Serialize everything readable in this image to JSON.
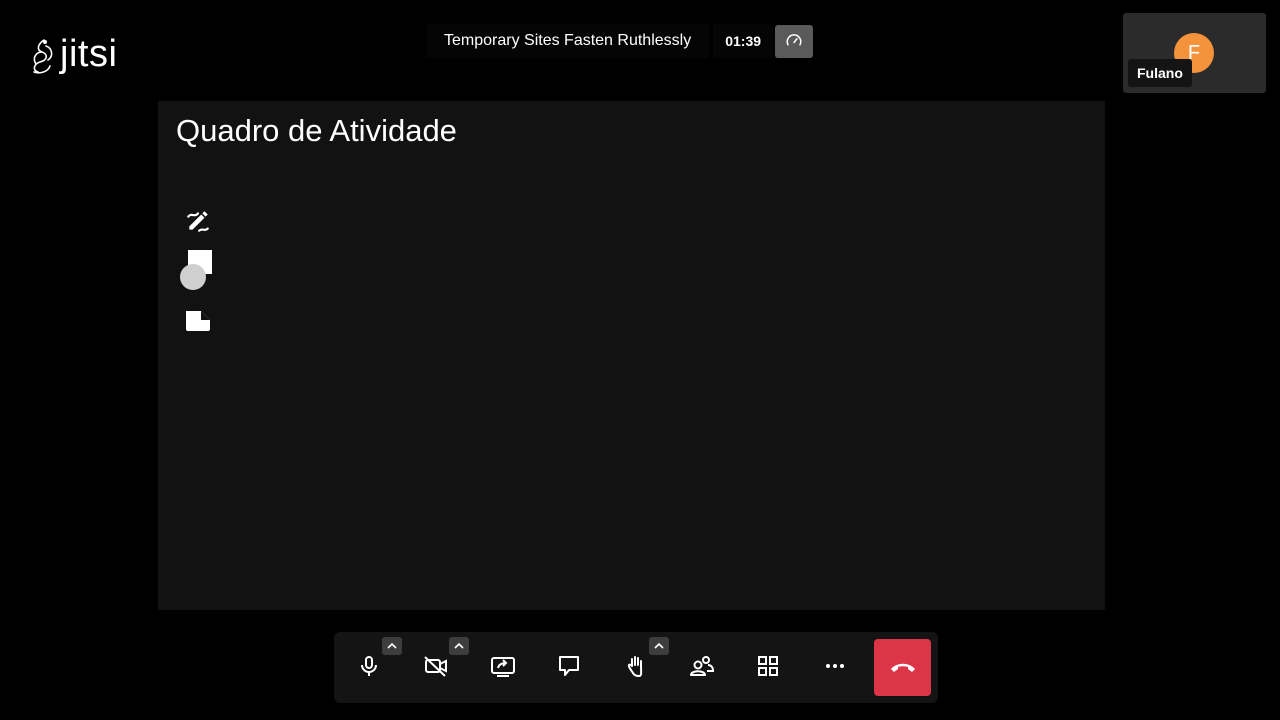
{
  "logo": {
    "text": "jitsi"
  },
  "header": {
    "meeting_title": "Temporary Sites Fasten Ruthlessly",
    "timer": "01:39",
    "performance_icon": "speedometer-icon"
  },
  "participant": {
    "initial": "F",
    "name": "Fulano",
    "avatar_color": "#f5933c"
  },
  "whiteboard": {
    "title": "Quadro de Atividade",
    "tools": [
      "pencil-icon",
      "shapes-icon",
      "sticky-note-icon"
    ]
  },
  "toolbar": {
    "buttons": [
      "microphone-icon",
      "camera-off-icon",
      "screen-share-icon",
      "chat-icon",
      "raise-hand-icon",
      "participants-icon",
      "tile-view-icon",
      "more-icon",
      "hangup-icon"
    ],
    "hangup_color": "#dd3548"
  }
}
